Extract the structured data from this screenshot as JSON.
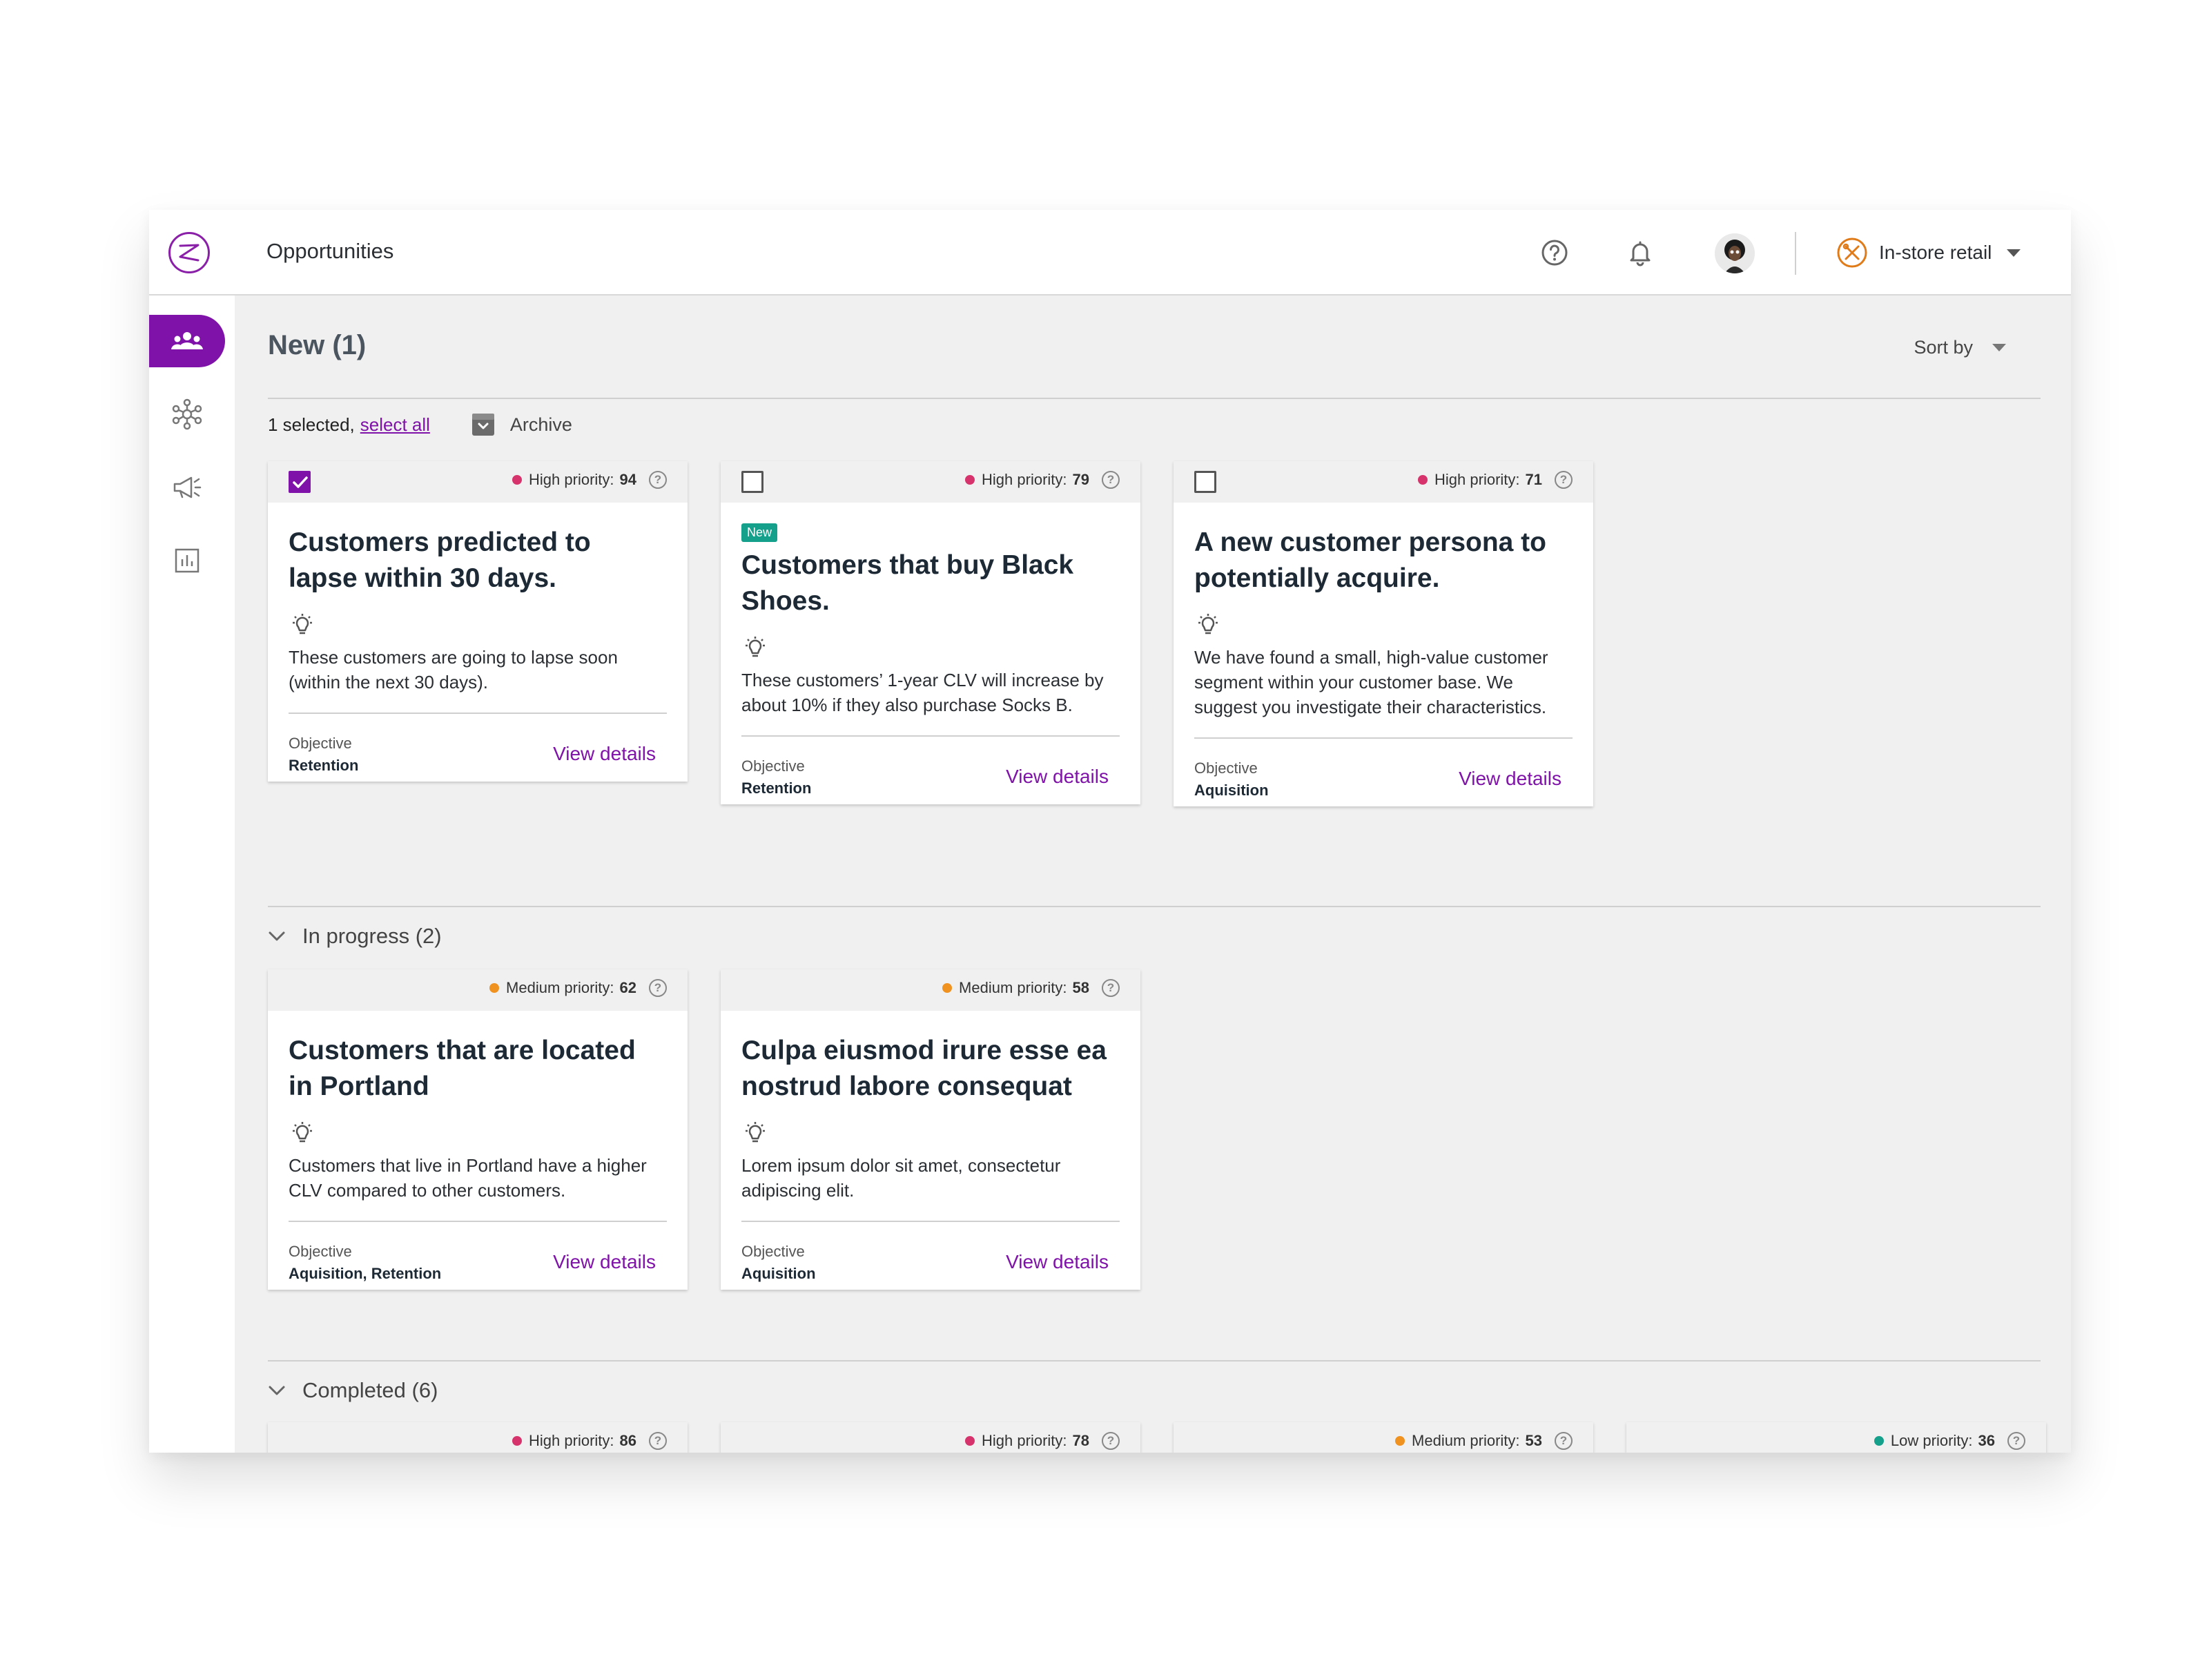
{
  "header": {
    "title": "Opportunities",
    "store_name": "In-store retail"
  },
  "new_section": {
    "title": "New (1)",
    "sort_label": "Sort by",
    "selected_text": "1 selected,",
    "select_all_label": "select all",
    "archive_label": "Archive",
    "cards": [
      {
        "checked": true,
        "priority_label": "High priority:",
        "priority_score": "94",
        "title": "Customers predicted to lapse within 30 days.",
        "description": "These customers are going to lapse soon (within the next 30 days).",
        "objective_label": "Objective",
        "objective_value": "Retention",
        "view_label": "View details"
      },
      {
        "checked": false,
        "badge": "New",
        "priority_label": "High priority:",
        "priority_score": "79",
        "title": "Customers that buy Black Shoes.",
        "description": "These customers’ 1-year CLV will increase by about 10% if they also purchase Socks B.",
        "objective_label": "Objective",
        "objective_value": "Retention",
        "view_label": "View details"
      },
      {
        "checked": false,
        "priority_label": "High priority:",
        "priority_score": "71",
        "title": "A new customer persona to potentially acquire.",
        "description": "We have found a small, high-value customer segment within your customer base. We suggest you investigate their characteristics.",
        "objective_label": "Objective",
        "objective_value": "Aquisition",
        "view_label": "View details"
      }
    ]
  },
  "in_progress": {
    "title": "In progress (2)",
    "cards": [
      {
        "priority_label": "Medium priority:",
        "priority_score": "62",
        "title": "Customers that are located in Portland",
        "description": "Customers that live in Portland have a higher CLV compared to other customers.",
        "objective_label": "Objective",
        "objective_value": "Aquisition, Retention",
        "view_label": "View details"
      },
      {
        "priority_label": "Medium priority:",
        "priority_score": "58",
        "title": "Culpa eiusmod irure esse ea nostrud labore consequat",
        "description": "Lorem ipsum dolor sit amet, consectetur adipiscing elit.",
        "objective_label": "Objective",
        "objective_value": "Aquisition",
        "view_label": "View details"
      }
    ]
  },
  "completed": {
    "title": "Completed (6)",
    "cards": [
      {
        "priority_label": "High priority:",
        "priority_score": "86"
      },
      {
        "priority_label": "High priority:",
        "priority_score": "78"
      },
      {
        "priority_label": "Medium priority:",
        "priority_score": "53"
      },
      {
        "priority_label": "Low priority:",
        "priority_score": "36"
      }
    ]
  },
  "colors": {
    "accent": "#7f12a8",
    "high": "#d6336c",
    "medium": "#f0921f",
    "low": "#14a08a",
    "badge": "#14a08a"
  }
}
